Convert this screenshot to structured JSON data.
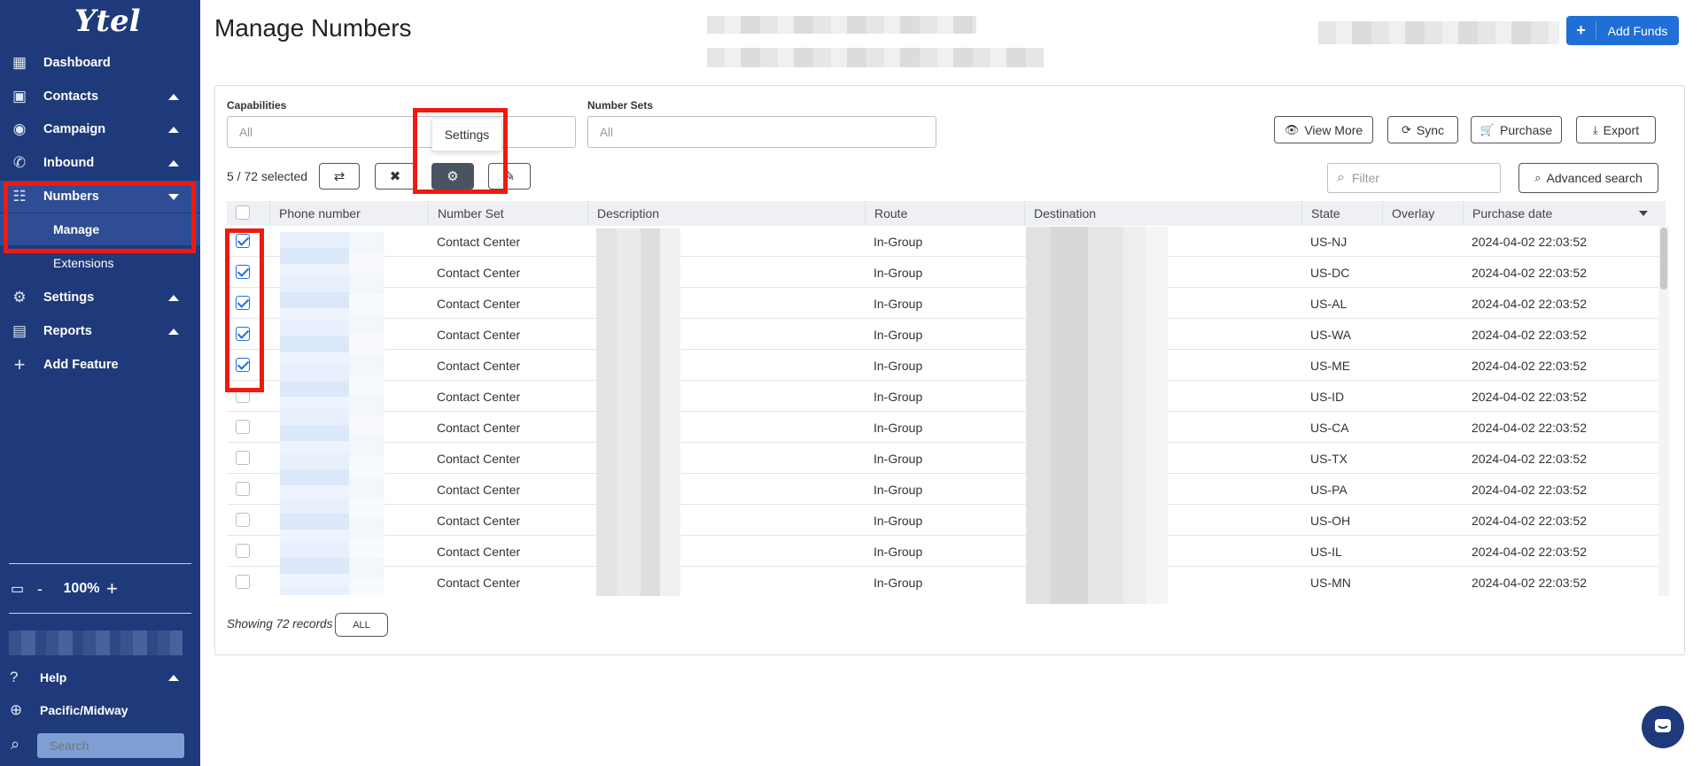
{
  "sidebar": {
    "logo": "Ytel",
    "items": [
      {
        "label": "Dashboard",
        "icon": "dashboard-icon"
      },
      {
        "label": "Contacts",
        "icon": "contacts-icon"
      },
      {
        "label": "Campaign",
        "icon": "campaign-icon"
      },
      {
        "label": "Inbound",
        "icon": "inbound-icon"
      },
      {
        "label": "Numbers",
        "icon": "numbers-icon"
      },
      {
        "label": "Settings",
        "icon": "gear-icon"
      },
      {
        "label": "Reports",
        "icon": "reports-icon"
      },
      {
        "label": "Add Feature",
        "icon": "plus-icon"
      }
    ],
    "sub_items": [
      {
        "label": "Manage"
      },
      {
        "label": "Extensions"
      }
    ],
    "zoom": {
      "minus": "-",
      "value": "100%",
      "plus": "+"
    },
    "help_label": "Help",
    "timezone_label": "Pacific/Midway",
    "search_placeholder": "Search"
  },
  "header": {
    "title": "Manage Numbers",
    "add_funds_label": "Add Funds",
    "add_funds_plus": "+"
  },
  "filters": {
    "capabilities_label": "Capabilities",
    "capabilities_value": "All",
    "number_sets_label": "Number Sets",
    "number_sets_value": "All"
  },
  "actions": {
    "view_more": "View More",
    "sync": "Sync",
    "purchase": "Purchase",
    "export": "Export",
    "advanced_search": "Advanced search",
    "filter_placeholder": "Filter"
  },
  "toolbar": {
    "selected_count": "5 / 72 selected",
    "tooltip": "Settings"
  },
  "table": {
    "columns": [
      "Phone number",
      "Number Set",
      "Description",
      "Route",
      "Destination",
      "State",
      "Overlay",
      "Purchase date"
    ],
    "rows": [
      {
        "checked": true,
        "number_set": "Contact Center",
        "route": "In-Group",
        "state": "US-NJ",
        "purchase_date": "2024-04-02 22:03:52"
      },
      {
        "checked": true,
        "number_set": "Contact Center",
        "route": "In-Group",
        "state": "US-DC",
        "purchase_date": "2024-04-02 22:03:52"
      },
      {
        "checked": true,
        "number_set": "Contact Center",
        "route": "In-Group",
        "state": "US-AL",
        "purchase_date": "2024-04-02 22:03:52"
      },
      {
        "checked": true,
        "number_set": "Contact Center",
        "route": "In-Group",
        "state": "US-WA",
        "purchase_date": "2024-04-02 22:03:52"
      },
      {
        "checked": true,
        "number_set": "Contact Center",
        "route": "In-Group",
        "state": "US-ME",
        "purchase_date": "2024-04-02 22:03:52"
      },
      {
        "checked": false,
        "number_set": "Contact Center",
        "route": "In-Group",
        "state": "US-ID",
        "purchase_date": "2024-04-02 22:03:52"
      },
      {
        "checked": false,
        "number_set": "Contact Center",
        "route": "In-Group",
        "state": "US-CA",
        "purchase_date": "2024-04-02 22:03:52"
      },
      {
        "checked": false,
        "number_set": "Contact Center",
        "route": "In-Group",
        "state": "US-TX",
        "purchase_date": "2024-04-02 22:03:52"
      },
      {
        "checked": false,
        "number_set": "Contact Center",
        "route": "In-Group",
        "state": "US-PA",
        "purchase_date": "2024-04-02 22:03:52"
      },
      {
        "checked": false,
        "number_set": "Contact Center",
        "route": "In-Group",
        "state": "US-OH",
        "purchase_date": "2024-04-02 22:03:52"
      },
      {
        "checked": false,
        "number_set": "Contact Center",
        "route": "In-Group",
        "state": "US-IL",
        "purchase_date": "2024-04-02 22:03:52"
      },
      {
        "checked": false,
        "number_set": "Contact Center",
        "route": "In-Group",
        "state": "US-MN",
        "purchase_date": "2024-04-02 22:03:52"
      }
    ]
  },
  "footer": {
    "showing": "Showing 72 records",
    "all_button": "ALL"
  },
  "colors": {
    "sidebar_bg": "#1f3a7a",
    "accent": "#1f6fd6",
    "highlight": "#f0190f"
  }
}
